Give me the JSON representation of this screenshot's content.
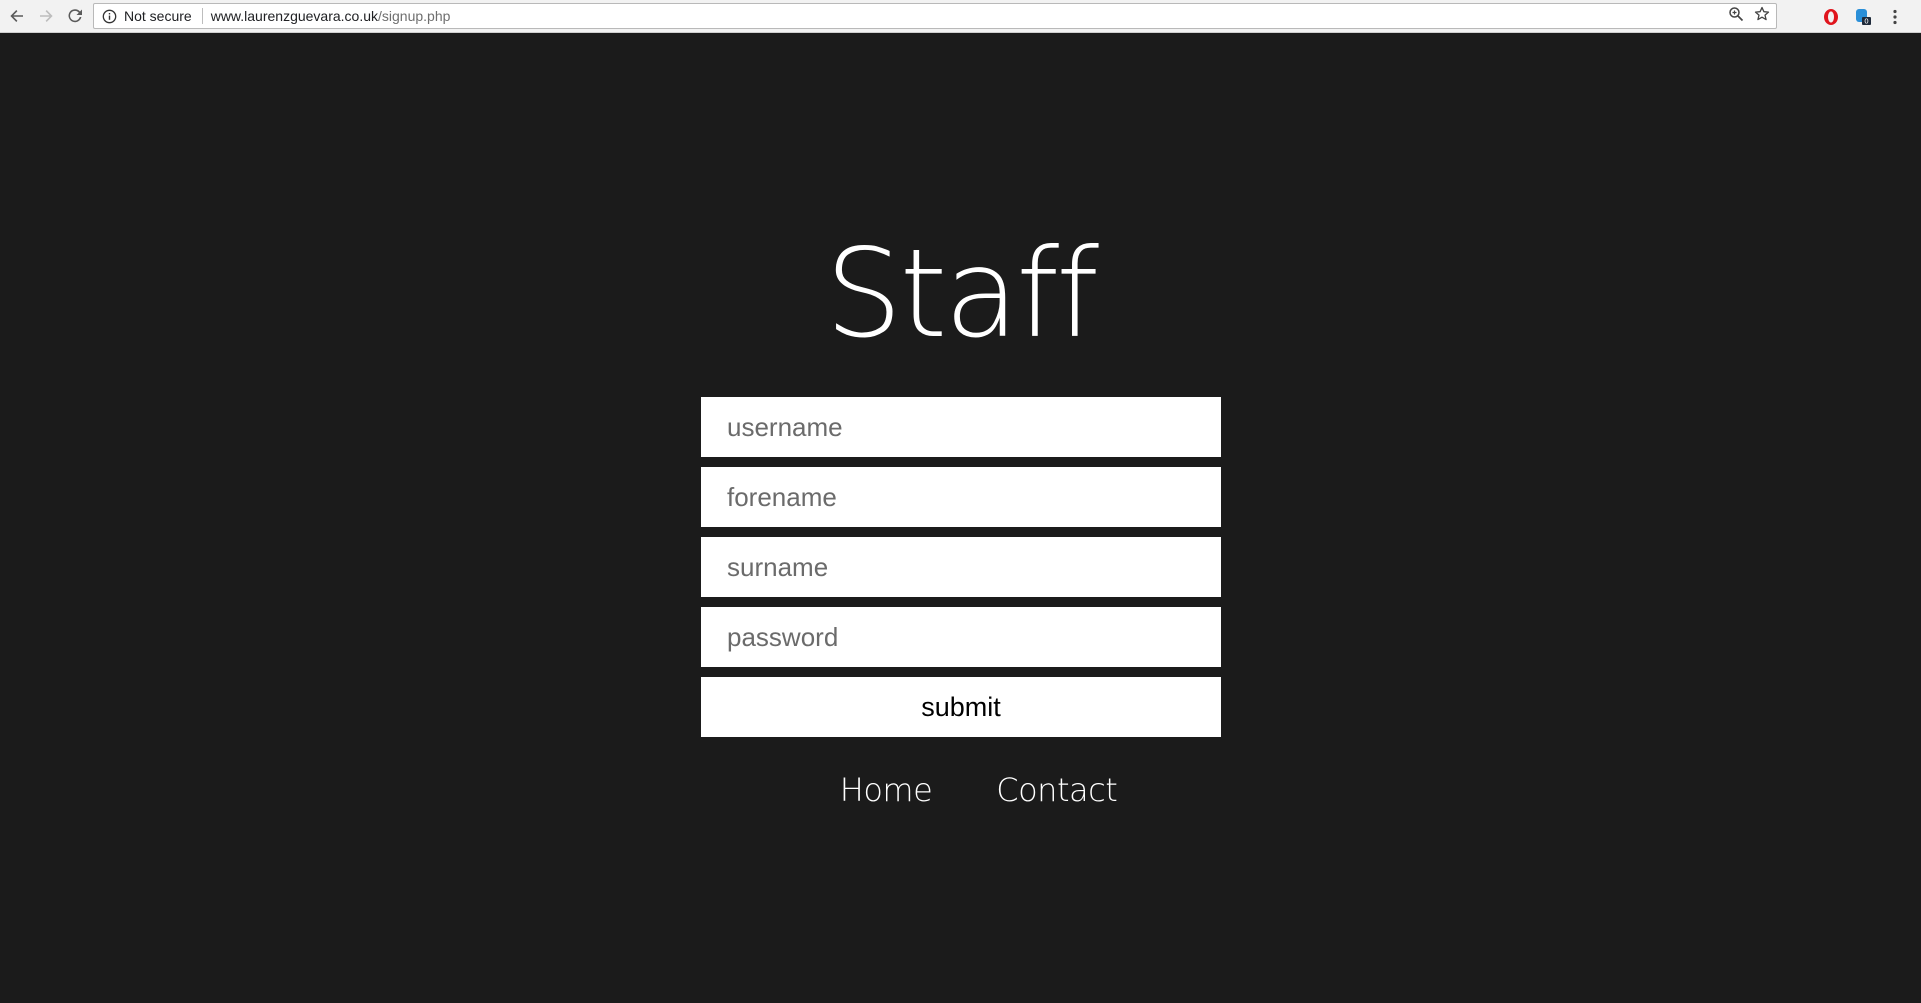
{
  "browser": {
    "security_label": "Not secure",
    "url_host": "www.laurenzguevara.co.uk",
    "url_path": "/signup.php"
  },
  "icons": {
    "back": "back-arrow-icon",
    "forward": "forward-arrow-icon",
    "reload": "reload-icon",
    "info": "info-icon",
    "zoom": "zoom-icon",
    "bookmark": "star-icon",
    "opera_ext": "opera-icon",
    "ext2": "extension-icon",
    "menu": "kebab-menu-icon"
  },
  "colors": {
    "page_background": "#1b1b1b",
    "title_text": "#ffffff",
    "field_background": "#ffffff",
    "placeholder_text": "#6b6b6b"
  },
  "page": {
    "title": "Staff",
    "form": {
      "username_placeholder": "username",
      "forename_placeholder": "forename",
      "surname_placeholder": "surname",
      "password_placeholder": "password",
      "submit_label": "submit"
    },
    "nav": {
      "home": "Home",
      "contact": "Contact"
    }
  }
}
